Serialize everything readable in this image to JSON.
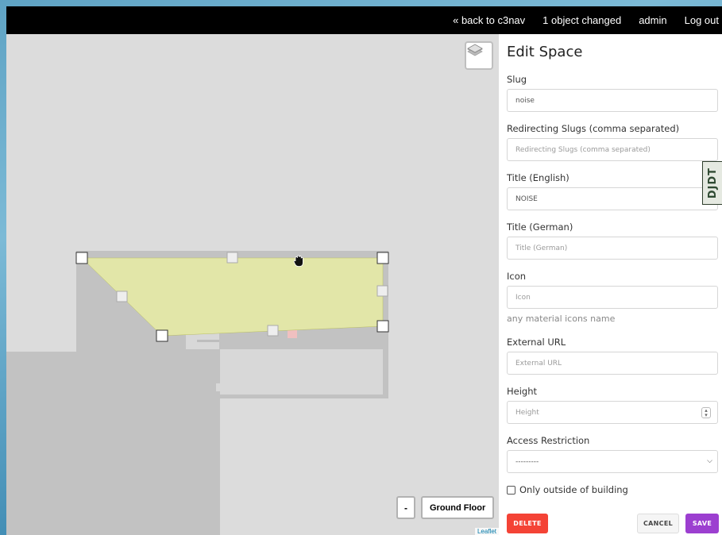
{
  "topbar": {
    "back_link": "« back to c3nav",
    "changes": "1 object changed",
    "user": "admin",
    "logout": "Log out"
  },
  "map": {
    "floor_minus": "-",
    "floor_label": "Ground Floor",
    "attribution": "Leaflet"
  },
  "form": {
    "title": "Edit Space",
    "slug_label": "Slug",
    "slug_value": "noise",
    "redirect_label": "Redirecting Slugs (comma separated)",
    "redirect_placeholder": "Redirecting Slugs (comma separated)",
    "title_en_label": "Title (English)",
    "title_en_value": "NOISE",
    "title_de_label": "Title (German)",
    "title_de_placeholder": "Title (German)",
    "icon_label": "Icon",
    "icon_placeholder": "Icon",
    "icon_help": "any material icons name",
    "url_label": "External URL",
    "url_placeholder": "External URL",
    "height_label": "Height",
    "height_placeholder": "Height",
    "access_label": "Access Restriction",
    "access_value": "---------",
    "outside_label": "Only outside of building",
    "delete": "DELETE",
    "cancel": "CANCEL",
    "save": "SAVE"
  },
  "debug_toolbar": {
    "label": "DJDT"
  },
  "colors": {
    "topbar": "#000000",
    "selected_space": "#e2e6a8",
    "delete": "#f44336",
    "save": "#9c3fd0"
  }
}
